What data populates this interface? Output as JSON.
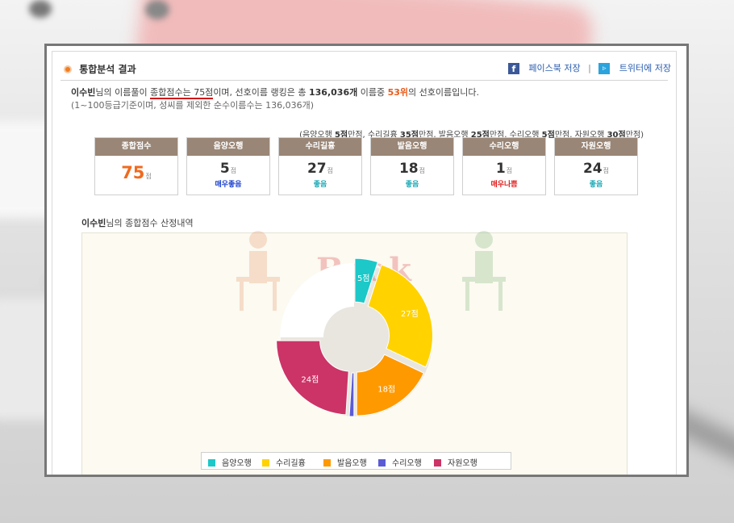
{
  "header": {
    "title": "통합분석 결과",
    "facebook_label": "페이스북 저장",
    "twitter_label": "트위터에 저장",
    "separator": "|"
  },
  "summary": {
    "name": "이수빈",
    "part1": "님의 이름풀이 ",
    "score_label": "종합점수는 75점",
    "part2": "이며, 선호이름 랭킹은 총 ",
    "total_names": "136,036개",
    "part3": " 이름중 ",
    "rank": "53위",
    "part4": "의 선호이름입니다.",
    "subline": "(1~100등급기준이며, 성씨를 제외한 순수이름수는 136,036개)"
  },
  "max_note": {
    "open": "(음양오행 ",
    "a": "5점",
    "a_t": "만점, 수리길흉 ",
    "b": "35점",
    "b_t": "만점, 발음오행 ",
    "c": "25점",
    "c_t": "만점, 수리오행 ",
    "d": "5점",
    "d_t": "만점, 자원오행 ",
    "e": "30점",
    "e_t": "만점)"
  },
  "scores": [
    {
      "title": "종합점수",
      "value": "75",
      "unit": "점",
      "grade": "",
      "grade_color": "#f06a1f"
    },
    {
      "title": "음양오행",
      "value": "5",
      "unit": "점",
      "grade": "매우좋음",
      "grade_color": "#1a3fcf"
    },
    {
      "title": "수리길흉",
      "value": "27",
      "unit": "점",
      "grade": "좋음",
      "grade_color": "#19a8b5"
    },
    {
      "title": "발음오행",
      "value": "18",
      "unit": "점",
      "grade": "좋음",
      "grade_color": "#19a8b5"
    },
    {
      "title": "수리오행",
      "value": "1",
      "unit": "점",
      "grade": "매우나쁨",
      "grade_color": "#e21b1b"
    },
    {
      "title": "자원오행",
      "value": "24",
      "unit": "점",
      "grade": "좋음",
      "grade_color": "#19a8b5"
    }
  ],
  "chart_section": {
    "name": "이수빈",
    "title_suffix": "님의 종합점수 산정내역",
    "watermark": "Book"
  },
  "chart_data": {
    "type": "pie",
    "donut": true,
    "total": 100,
    "series": [
      {
        "name": "음양오행",
        "value": 5,
        "label": "5점",
        "color": "#1cc8c8"
      },
      {
        "name": "수리길흉",
        "value": 27,
        "label": "27점",
        "color": "#ffd200"
      },
      {
        "name": "발음오행",
        "value": 18,
        "label": "18점",
        "color": "#ff9900"
      },
      {
        "name": "수리오행",
        "value": 1,
        "label": "",
        "color": "#5b5bd6"
      },
      {
        "name": "자원오행",
        "value": 24,
        "label": "24점",
        "color": "#cc3366"
      }
    ],
    "remainder_color": "#ffffff",
    "legend_placement": "bottom"
  }
}
